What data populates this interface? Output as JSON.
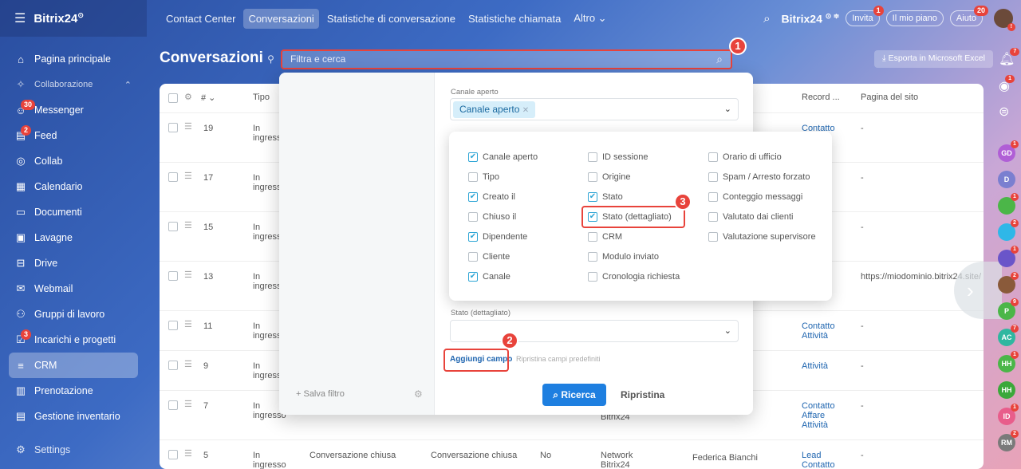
{
  "topbar": {
    "logo": "Bitrix24",
    "logo_suffix": "⊙",
    "nav": [
      "Contact Center",
      "Conversazioni",
      "Statistiche di conversazione",
      "Statistiche chiamata",
      "Altro ⌄"
    ],
    "brand_right": "Bitrix24",
    "invite": "Invita",
    "invite_badge": "1",
    "my_plan": "Il mio piano",
    "help": "Aiuto",
    "help_badge": "20"
  },
  "sidebar": {
    "items": [
      {
        "label": "Pagina principale",
        "icon": "⌂"
      },
      {
        "label": "Collaborazione",
        "icon": "✧",
        "chevron": "⌃"
      },
      {
        "label": "Messenger",
        "icon": "☺",
        "badge": "30"
      },
      {
        "label": "Feed",
        "icon": "▤",
        "badge": "2"
      },
      {
        "label": "Collab",
        "icon": "◎"
      },
      {
        "label": "Calendario",
        "icon": "▦"
      },
      {
        "label": "Documenti",
        "icon": "▭"
      },
      {
        "label": "Lavagne",
        "icon": "▣"
      },
      {
        "label": "Drive",
        "icon": "⊟"
      },
      {
        "label": "Webmail",
        "icon": "✉"
      },
      {
        "label": "Gruppi di lavoro",
        "icon": "⚇"
      },
      {
        "label": "Incarichi e progetti",
        "icon": "☑",
        "badge": "3"
      },
      {
        "label": "CRM",
        "icon": "≡"
      },
      {
        "label": "Prenotazione",
        "icon": "▥"
      },
      {
        "label": "Gestione inventario",
        "icon": "▤"
      },
      {
        "label": "Settings",
        "icon": "⚙"
      }
    ]
  },
  "page": {
    "title": "Conversazioni",
    "search_placeholder": "Filtra e cerca",
    "export": "Esporta in Microsoft Excel"
  },
  "grid": {
    "headers": {
      "num": "#",
      "tipo": "Tipo",
      "record": "Record ...",
      "pagina": "Pagina del sito"
    },
    "rows": [
      {
        "num": "19",
        "tipo": "In ingresso",
        "record": "Contatto",
        "pagina": "-"
      },
      {
        "num": "17",
        "tipo": "In ingresso",
        "record": "",
        "pagina": "-"
      },
      {
        "num": "15",
        "tipo": "In ingresso",
        "record": "",
        "pagina": "-"
      },
      {
        "num": "13",
        "tipo": "In ingresso",
        "record": "",
        "pagina": "https://miodominio.bitrix24.site/"
      },
      {
        "num": "11",
        "tipo": "In ingresso",
        "record": "Contatto\nAttività",
        "pagina": "-"
      },
      {
        "num": "9",
        "tipo": "In ingresso",
        "record": "Attività",
        "pagina": "-"
      },
      {
        "num": "7",
        "tipo": "In ingresso",
        "record": "Contatto\nAffare\nAttività",
        "pagina": "-"
      },
      {
        "num": "5",
        "tipo": "In ingresso",
        "stato": "Conversazione chiusa",
        "stato2": "Conversazione chiusa",
        "no": "No",
        "canale": "Network\nBitrix24",
        "dip": "Federica Bianchi",
        "record": "Lead\nContatto",
        "pagina": "-"
      }
    ],
    "row7_extra": "Bitrix24"
  },
  "filter": {
    "label_canale": "Canale aperto",
    "chip_canale": "Canale aperto",
    "label_stato_det": "Stato (dettagliato)",
    "add_field": "Aggiungi campo",
    "reset_fields": "Ripristina campi predefiniti",
    "save_filter": "+ Salva filtro",
    "search_btn": "Ricerca",
    "reset_btn": "Ripristina"
  },
  "fields": [
    {
      "label": "Canale aperto",
      "checked": true
    },
    {
      "label": "ID sessione",
      "checked": false
    },
    {
      "label": "Orario di ufficio",
      "checked": false
    },
    {
      "label": "Tipo",
      "checked": false
    },
    {
      "label": "Origine",
      "checked": false
    },
    {
      "label": "Spam / Arresto forzato",
      "checked": false
    },
    {
      "label": "Creato il",
      "checked": true
    },
    {
      "label": "Stato",
      "checked": true
    },
    {
      "label": "Conteggio messaggi",
      "checked": false
    },
    {
      "label": "Chiuso il",
      "checked": false
    },
    {
      "label": "Stato (dettagliato)",
      "checked": true
    },
    {
      "label": "Valutato dai clienti",
      "checked": false
    },
    {
      "label": "Dipendente",
      "checked": true
    },
    {
      "label": "CRM",
      "checked": false
    },
    {
      "label": "Valutazione supervisore",
      "checked": false
    },
    {
      "label": "Cliente",
      "checked": false
    },
    {
      "label": "Modulo inviato",
      "checked": false
    },
    {
      "label": "Canale",
      "checked": true
    },
    {
      "label": "Cronologia richiesta",
      "checked": false
    }
  ],
  "steps": [
    "1",
    "2",
    "3"
  ],
  "rightbar": {
    "avatars": [
      {
        "label": "GD",
        "color": "#b05fd6",
        "badge": "1"
      },
      {
        "label": "D",
        "color": "#7a7fd0",
        "badge": ""
      },
      {
        "label": "",
        "color": "#4bb648",
        "badge": "1"
      },
      {
        "label": "",
        "color": "#2fb7e8",
        "badge": "2"
      },
      {
        "label": "",
        "color": "#6a55c9",
        "badge": "1"
      },
      {
        "label": "",
        "color": "#8a5a3a",
        "badge": "2"
      },
      {
        "label": "P",
        "color": "#4bb648",
        "badge": "9"
      },
      {
        "label": "AC",
        "color": "#2fb7a0",
        "badge": "7"
      },
      {
        "label": "HH",
        "color": "#4bb648",
        "badge": "1"
      },
      {
        "label": "HH",
        "color": "#3ba83a",
        "badge": ""
      },
      {
        "label": "ID",
        "color": "#e85d8b",
        "badge": "1"
      },
      {
        "label": "RM",
        "color": "#7a7a7a",
        "badge": "2"
      }
    ],
    "notif_badge": "7",
    "copilot_badge": "1"
  },
  "colors": {
    "accent": "#2fa6d6",
    "annotation": "#e8433b",
    "primary_btn": "#1e7fe0"
  }
}
